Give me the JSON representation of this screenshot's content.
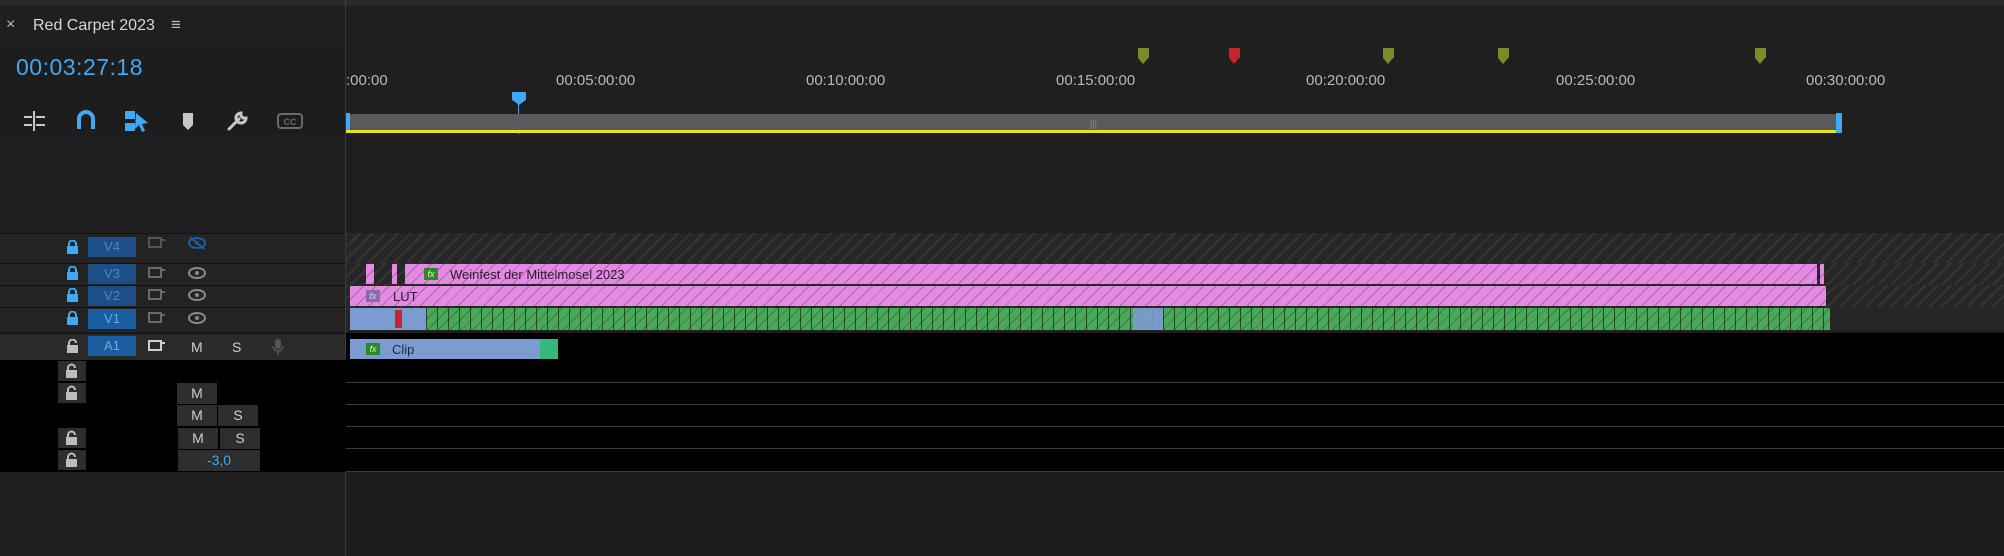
{
  "tab": {
    "close": "×",
    "title": "Red Carpet 2023",
    "menu": "≡"
  },
  "timecode": "00:03:27:18",
  "tools": [
    {
      "name": "insert-nested-icon",
      "glyph": "⫶"
    },
    {
      "name": "snap-magnet-icon",
      "glyph": "∩"
    },
    {
      "name": "linked-selection-icon",
      "glyph": "⤡"
    },
    {
      "name": "add-marker-icon",
      "glyph": "⬟"
    },
    {
      "name": "timeline-settings-wrench-icon",
      "glyph": "🔧"
    },
    {
      "name": "captions-cc-icon",
      "glyph": "CC"
    }
  ],
  "ruler": {
    "labels": [
      ":00:00",
      "00:05:00:00",
      "00:10:00:00",
      "00:15:00:00",
      "00:20:00:00",
      "00:25:00:00",
      "00:30:00:00"
    ]
  },
  "colors": {
    "accent": "#3fa9f5",
    "track_label_bg": "#1a5da0",
    "clip_pink": "#e38ae2",
    "clip_green": "#4aa85a",
    "clip_blue": "#7c9bd0",
    "marker_green": "#7a8c2a",
    "marker_red": "#c8242e",
    "work_area_yellow": "#e8e020"
  },
  "tracks": {
    "video": [
      {
        "label": "V4"
      },
      {
        "label": "V3"
      },
      {
        "label": "V2"
      },
      {
        "label": "V1"
      }
    ],
    "audio": [
      {
        "label": "A1",
        "m": "M",
        "s": "S"
      }
    ],
    "submix": {
      "m1": "M",
      "m2": "M",
      "s2": "S",
      "m3": "M",
      "s3": "S",
      "volume": "-3,0"
    }
  },
  "clips": {
    "v3_title": "Weinfest der Mittelmosel 2023",
    "v2_title": "LUT",
    "a1_title": "Clip",
    "fx_badge": "fx"
  }
}
